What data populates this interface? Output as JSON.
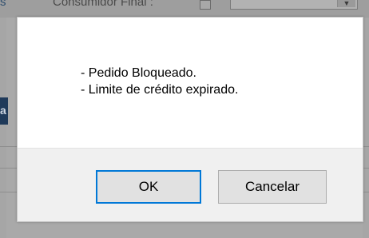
{
  "background": {
    "left_fragment": "s",
    "field_label": "Consumidor Final :",
    "tab_fragment": "a",
    "select_arrow": "▼"
  },
  "dialog": {
    "messages": [
      "- Pedido Bloqueado.",
      "- Limite de crédito expirado."
    ],
    "ok_label": "OK",
    "cancel_label": "Cancelar"
  },
  "colors": {
    "focus_border": "#0078d7",
    "footer_bg": "#f0f0f0",
    "overlay_bg": "#a9a9a9"
  }
}
